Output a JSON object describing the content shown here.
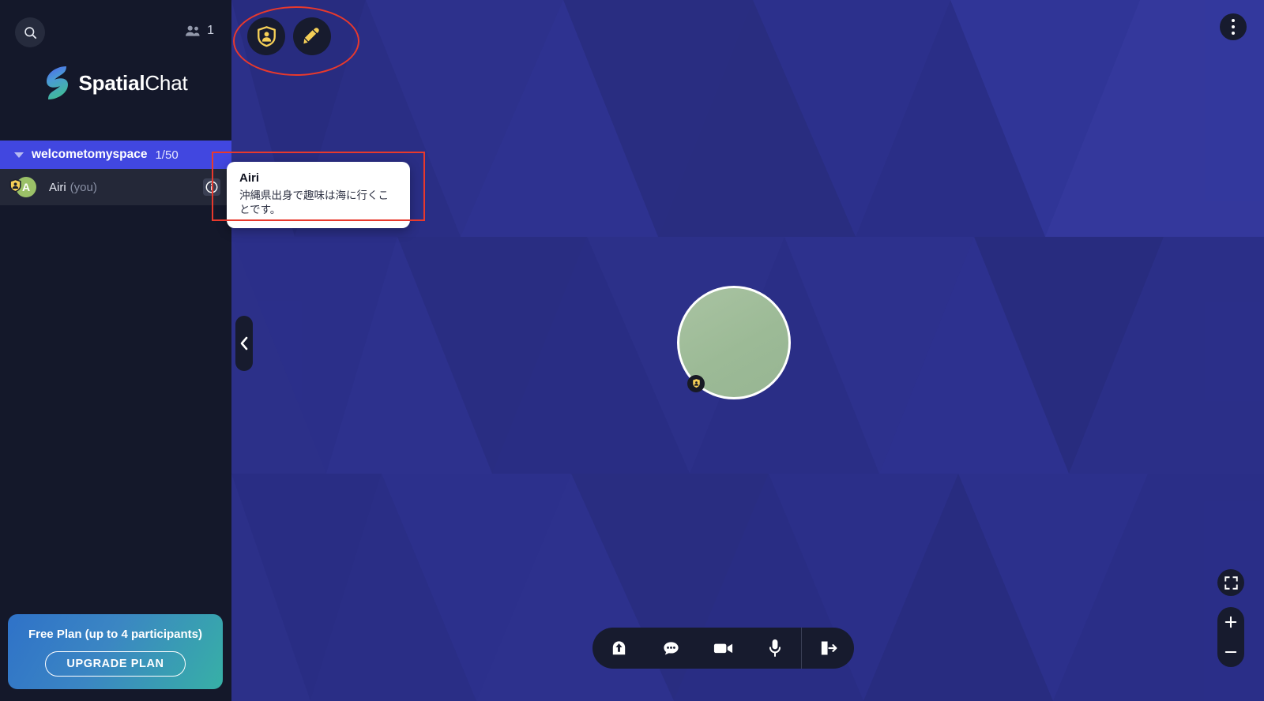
{
  "app": {
    "brand_bold": "Spatial",
    "brand_light": "Chat",
    "logo_icon": "spatialchat-s-logo",
    "accent_blue": "#4147e0",
    "badge_yellow": "#f5cf57",
    "stage_blue": "#2a2e86",
    "sidebar_bg": "#14182a"
  },
  "sidebar": {
    "search": {
      "icon": "search-icon",
      "label": "Search"
    },
    "people_counter": {
      "icon": "people-icon",
      "count": "1"
    },
    "room": {
      "name": "welcometomyspace",
      "capacity": "1/50",
      "caret_icon": "caret-down-icon"
    },
    "participants": [
      {
        "initial": "A",
        "name": "Airi",
        "you_suffix": "(you)",
        "badge_icon": "host-shield-icon",
        "info_icon": "info-icon",
        "avatar_color": "#9bc168"
      }
    ],
    "upgrade": {
      "title": "Free Plan (up to 4 participants)",
      "button_label": "UPGRADE PLAN"
    }
  },
  "stage": {
    "tools": [
      {
        "name": "moderator-badge-button",
        "icon": "shield-person-icon"
      },
      {
        "name": "draw-button",
        "icon": "pencil-icon"
      }
    ],
    "menu": {
      "icon": "more-vertical-icon"
    },
    "collapse_handle": {
      "icon": "chevron-left-icon"
    },
    "avatar": {
      "name": "Airi",
      "badge_icon": "host-shield-icon",
      "fill_color": "#9cba96"
    },
    "bottom_toolbar": [
      {
        "name": "share-screen-button",
        "icon": "share-up-icon"
      },
      {
        "name": "chat-button",
        "icon": "chat-bubble-icon"
      },
      {
        "name": "camera-button",
        "icon": "video-camera-icon"
      },
      {
        "name": "microphone-button",
        "icon": "microphone-icon"
      },
      {
        "name": "leave-button",
        "icon": "exit-door-icon"
      }
    ],
    "fit_button": {
      "icon": "fit-screen-icon"
    },
    "zoom_in": {
      "icon": "plus-icon",
      "label": "+"
    },
    "zoom_out": {
      "icon": "minus-icon",
      "label": "−"
    }
  },
  "tooltip": {
    "name": "Airi",
    "description": "沖縄県出身で趣味は海に行くことです。"
  },
  "annotations": {
    "color": "#e8392c",
    "ellipse_target": "stage-tools",
    "rect_target": "profile-tooltip"
  }
}
